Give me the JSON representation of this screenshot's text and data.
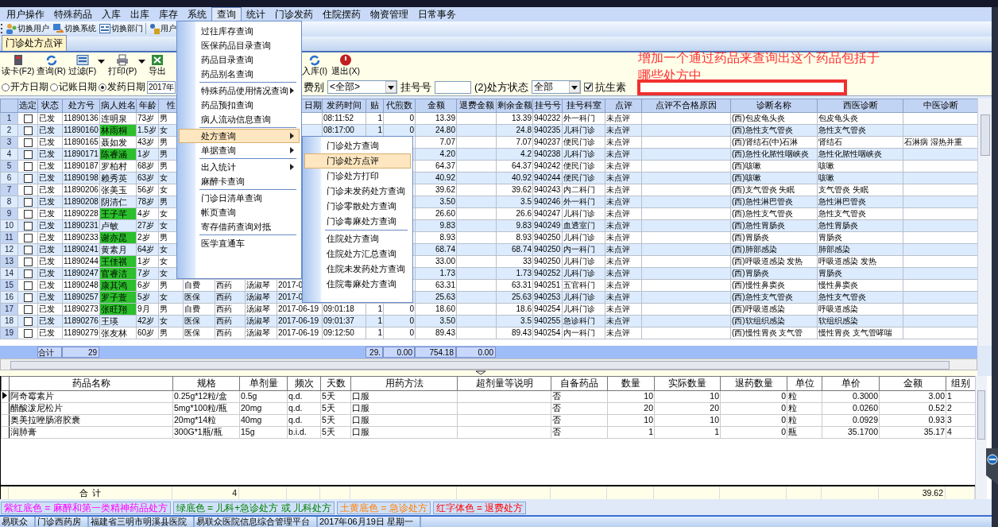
{
  "menubar": [
    {
      "label": "用户操作",
      "selected": false
    },
    {
      "label": "特殊药品",
      "selected": false
    },
    {
      "label": "入库",
      "selected": false
    },
    {
      "label": "出库",
      "selected": false
    },
    {
      "label": "库存",
      "selected": false
    },
    {
      "label": "系统",
      "selected": false
    },
    {
      "label": "查询",
      "selected": true
    },
    {
      "label": "统计",
      "selected": false
    },
    {
      "label": "门诊发药",
      "selected": false
    },
    {
      "label": "住院摆药",
      "selected": false
    },
    {
      "label": "物资管理",
      "selected": false
    },
    {
      "label": "日常事务",
      "selected": false
    }
  ],
  "toolbar": [
    {
      "label": "切换用户"
    },
    {
      "label": "切换系统"
    },
    {
      "label": "切换部门"
    },
    {
      "label": "用户"
    }
  ],
  "tabs": [
    {
      "label": "门诊处方点评",
      "selected": true
    }
  ],
  "actions_left": [
    {
      "label": "读卡(F2)",
      "dropdown": false
    },
    {
      "label": "查询(R)",
      "dropdown": false
    },
    {
      "label": "过滤(F)",
      "dropdown": true
    },
    {
      "label": "打印(P)",
      "dropdown": true
    },
    {
      "label": "导出",
      "dropdown": false
    }
  ],
  "actions_right": [
    {
      "label": "入库(I)"
    },
    {
      "label": "退出(X)"
    }
  ],
  "annotation": "增加一个通过药品来查询出这个药品包括于哪些处方中",
  "filter": {
    "date_modes": [
      {
        "label": "开方日期",
        "selected": false
      },
      {
        "label": "记账日期",
        "selected": false
      },
      {
        "label": "发药日期",
        "selected": true
      }
    ],
    "date_from": "2017年",
    "fee_label": "费别",
    "fee_value": "<全部>",
    "reg_label": "挂号号",
    "status_label": "(2)处方状态",
    "status_value": "全部",
    "antibiotic": {
      "label": "抗生素",
      "checked": true
    }
  },
  "top_table": {
    "columns": [
      null,
      "选定",
      "状态",
      "处方号",
      "病人姓名",
      "年龄",
      "性",
      null,
      null,
      null,
      "日期",
      "发药时间",
      "贴",
      "代煎数",
      "金额",
      "退费金额",
      "剩余金额",
      "挂号号",
      "挂号科室",
      "点评",
      "点评不合格原因",
      "诊断名称",
      "西医诊断",
      "中医诊断"
    ],
    "rows": [
      {
        "checked": false,
        "highlighted": false,
        "cells": [
          "1",
          null,
          "已发",
          "11890136",
          "连明泉",
          "73岁",
          "男",
          null,
          null,
          null,
          null,
          "08:11:52",
          "1",
          "0",
          "13.39",
          null,
          "13.39",
          "940232",
          "外一科门",
          "未点评",
          null,
          "(西)包皮龟头炎",
          "包皮龟头炎",
          null
        ]
      },
      {
        "checked": false,
        "highlighted": true,
        "cells": [
          "2",
          null,
          "已发",
          "11890160",
          "林雨桐",
          "1.5岁",
          "女",
          null,
          null,
          null,
          null,
          "08:17:00",
          "1",
          "0",
          "24.80",
          null,
          "24.8",
          "940235",
          "儿科门诊",
          "未点评",
          null,
          "(西)急性支气管炎",
          "急性支气管炎",
          null
        ]
      },
      {
        "checked": false,
        "highlighted": false,
        "cells": [
          "3",
          null,
          "已发",
          "11890165",
          "聂如发",
          "43岁",
          "男",
          null,
          null,
          null,
          null,
          null,
          null,
          null,
          "7.07",
          null,
          "7.07",
          "940237",
          "便民门诊",
          "未点评",
          null,
          "(西)肾结石(中)石淋",
          "肾结石",
          "石淋病 湿热并重"
        ]
      },
      {
        "checked": false,
        "highlighted": true,
        "cells": [
          "4",
          null,
          "已发",
          "11890171",
          "陈睿涵",
          "1岁",
          "男",
          null,
          null,
          null,
          null,
          null,
          null,
          null,
          "4.20",
          null,
          "4.2",
          "940238",
          "儿科门诊",
          "未点评",
          null,
          "(西)急性化脓性咽峡炎",
          "急性化脓性咽峡炎",
          null
        ]
      },
      {
        "checked": false,
        "highlighted": false,
        "cells": [
          "5",
          null,
          "已发",
          "11890187",
          "罗柏村",
          "68岁",
          "男",
          null,
          null,
          null,
          null,
          null,
          null,
          null,
          "64.37",
          null,
          "64.37",
          "940242",
          "便民门诊",
          "未点评",
          null,
          "(西)咳嗽",
          "咳嗽",
          null
        ]
      },
      {
        "checked": false,
        "highlighted": false,
        "cells": [
          "6",
          null,
          "已发",
          "11890198",
          "赖秀英",
          "63岁",
          "女",
          null,
          null,
          null,
          null,
          null,
          null,
          null,
          "40.92",
          null,
          "40.92",
          "940244",
          "便民门诊",
          "未点评",
          null,
          "(西)咳嗽",
          "咳嗽",
          null
        ]
      },
      {
        "checked": false,
        "highlighted": false,
        "cells": [
          "7",
          null,
          "已发",
          "11890206",
          "张美玉",
          "56岁",
          "女",
          null,
          null,
          null,
          null,
          null,
          null,
          null,
          "39.62",
          null,
          "39.62",
          "940243",
          "内二科门",
          "未点评",
          null,
          "(西)支气管炎 失眠",
          "支气管炎 失眠",
          null
        ]
      },
      {
        "checked": false,
        "highlighted": false,
        "cells": [
          "8",
          null,
          "已发",
          "11890208",
          "阴清仁",
          "78岁",
          "男",
          null,
          null,
          null,
          null,
          null,
          null,
          null,
          "3.50",
          null,
          "3.5",
          "940246",
          "外一科门",
          "未点评",
          null,
          "(西)急性淋巴管炎",
          "急性淋巴管炎",
          null
        ]
      },
      {
        "checked": false,
        "highlighted": true,
        "cells": [
          "9",
          null,
          "已发",
          "11890228",
          "王子芊",
          "4岁",
          "女",
          null,
          null,
          null,
          null,
          null,
          null,
          null,
          "26.60",
          null,
          "26.6",
          "940247",
          "儿科门诊",
          "未点评",
          null,
          "(西)急性支气管炎",
          "急性支气管炎",
          null
        ]
      },
      {
        "checked": false,
        "highlighted": false,
        "cells": [
          "10",
          null,
          "已发",
          "11890231",
          "卢敏",
          "27岁",
          "女",
          null,
          null,
          null,
          null,
          null,
          null,
          null,
          "9.83",
          null,
          "9.83",
          "940249",
          "血透室门",
          "未点评",
          null,
          "(西)急性胃肠炎",
          "急性胃肠炎",
          null
        ]
      },
      {
        "checked": false,
        "highlighted": true,
        "cells": [
          "11",
          null,
          "已发",
          "11890233",
          "谢亦昆",
          "2岁",
          "男",
          null,
          null,
          null,
          null,
          null,
          null,
          null,
          "8.93",
          null,
          "8.93",
          "940250",
          "儿科门诊",
          "未点评",
          null,
          "(西)胃肠炎",
          "胃肠炎",
          null
        ]
      },
      {
        "checked": false,
        "highlighted": false,
        "cells": [
          "12",
          null,
          "已发",
          "11890241",
          "黄素月",
          "64岁",
          "女",
          null,
          null,
          null,
          null,
          null,
          null,
          null,
          "68.74",
          null,
          "68.74",
          "940250",
          "内一科门",
          "未点评",
          null,
          "(西)肺部感染",
          "肺部感染",
          null
        ]
      },
      {
        "checked": false,
        "highlighted": true,
        "cells": [
          "13",
          null,
          "已发",
          "11890244",
          "王佳祺",
          "1岁",
          "女",
          null,
          null,
          null,
          null,
          null,
          null,
          null,
          "33.00",
          null,
          "33",
          "940250",
          "儿科门诊",
          "未点评",
          null,
          "(西)呼吸道感染 发热",
          "呼吸道感染 发热",
          null
        ]
      },
      {
        "checked": false,
        "highlighted": true,
        "cells": [
          "14",
          null,
          "已发",
          "11890247",
          "官睿洁",
          "7岁",
          "女",
          null,
          null,
          null,
          null,
          null,
          null,
          null,
          "1.73",
          null,
          "1.73",
          "940252",
          "儿科门诊",
          "未点评",
          null,
          "(西)胃肠炎",
          "胃肠炎",
          null
        ]
      },
      {
        "checked": false,
        "highlighted": true,
        "cells": [
          "15",
          null,
          "已发",
          "11890248",
          "康其鸿",
          "6岁",
          "男",
          "自费",
          "西药",
          "汤淑琴",
          "2017-0",
          null,
          null,
          null,
          "63.31",
          null,
          "63.31",
          "940251",
          "五官科门",
          "未点评",
          null,
          "(西)慢性鼻窦炎",
          "慢性鼻窦炎",
          null
        ]
      },
      {
        "checked": false,
        "highlighted": true,
        "cells": [
          "16",
          null,
          "已发",
          "11890257",
          "罗子萱",
          "5岁",
          "女",
          "医保",
          "西药",
          "汤淑琴",
          "2017-0",
          null,
          null,
          null,
          "25.63",
          null,
          "25.63",
          "940253",
          "儿科门诊",
          "未点评",
          null,
          "(西)急性支气管炎",
          "急性支气管炎",
          null
        ]
      },
      {
        "checked": false,
        "highlighted": true,
        "cells": [
          "17",
          null,
          "已发",
          "11890273",
          "张旺翔",
          "9月",
          "男",
          "自费",
          "西药",
          "汤淑琴",
          "2017-06-19",
          "09:01:18",
          "1",
          "0",
          "18.60",
          null,
          "18.6",
          "940254",
          "儿科门诊",
          "未点评",
          null,
          "(西)呼吸道感染",
          "呼吸道感染",
          null
        ]
      },
      {
        "checked": false,
        "highlighted": false,
        "cells": [
          "18",
          null,
          "已发",
          "11890276",
          "王瑛",
          "42岁",
          "女",
          "医保",
          "西药",
          "汤淑琴",
          "2017-06-19",
          "09:01:37",
          "1",
          "0",
          "3.50",
          null,
          "3.5",
          "940255",
          "急诊科门",
          "未点评",
          null,
          "(西)软组织感染",
          "软组织感染",
          null
        ]
      },
      {
        "checked": false,
        "highlighted": false,
        "cells": [
          "19",
          null,
          "已发",
          "11890279",
          "张友林",
          "60岁",
          "男",
          "医保",
          "西药",
          "汤淑琴",
          "2017-06-19",
          "09:12:50",
          "1",
          "0",
          "89.43",
          null,
          "89.43",
          "940254",
          "内一科门",
          "未点评",
          null,
          "(西)慢性胃炎 支气管",
          "慢性胃炎 支气管哮喘",
          null
        ]
      }
    ],
    "total": {
      "label": "合计",
      "count": "29",
      "doses": "29.",
      "decoct": "0.00",
      "amount": "754.18",
      "refund": "0.00"
    }
  },
  "menu": [
    {
      "kind": "item",
      "label": "过往库存查询",
      "submenu": false,
      "selected": false
    },
    {
      "kind": "item",
      "label": "医保药品目录查询",
      "submenu": false,
      "selected": false
    },
    {
      "kind": "item",
      "label": "药品目录查询",
      "submenu": false,
      "selected": false
    },
    {
      "kind": "item",
      "label": "药品别名查询",
      "submenu": false,
      "selected": false
    },
    {
      "kind": "separator"
    },
    {
      "kind": "item",
      "label": "特殊药品使用情况查询",
      "submenu": true,
      "selected": false
    },
    {
      "kind": "item",
      "label": "药品预扣查询",
      "submenu": false,
      "selected": false
    },
    {
      "kind": "item",
      "label": "病人流动信息查询",
      "submenu": false,
      "selected": false
    },
    {
      "kind": "separator"
    },
    {
      "kind": "item",
      "label": "处方查询",
      "submenu": true,
      "selected": true
    },
    {
      "kind": "item",
      "label": "单据查询",
      "submenu": true,
      "selected": false
    },
    {
      "kind": "separator"
    },
    {
      "kind": "item",
      "label": "出入统计",
      "submenu": true,
      "selected": false
    },
    {
      "kind": "item",
      "label": "麻醉卡查询",
      "submenu": false,
      "selected": false
    },
    {
      "kind": "separator"
    },
    {
      "kind": "item",
      "label": "门诊日清单查询",
      "submenu": false,
      "selected": false
    },
    {
      "kind": "item",
      "label": "帐页查询",
      "submenu": false,
      "selected": false
    },
    {
      "kind": "item",
      "label": "寄存借药查询对抵",
      "submenu": false,
      "selected": false
    },
    {
      "kind": "separator"
    },
    {
      "kind": "item",
      "label": "医学直通车",
      "submenu": false,
      "selected": false
    }
  ],
  "submenu": [
    {
      "kind": "item",
      "label": "门诊处方查询",
      "selected": false
    },
    {
      "kind": "item",
      "label": "门诊处方点评",
      "selected": true
    },
    {
      "kind": "item",
      "label": "门诊处方打印",
      "selected": false
    },
    {
      "kind": "item",
      "label": "门诊未发药处方查询",
      "selected": false
    },
    {
      "kind": "item",
      "label": "门诊零散处方查询",
      "selected": false
    },
    {
      "kind": "item",
      "label": "门诊毒麻处方查询",
      "selected": false
    },
    {
      "kind": "separator"
    },
    {
      "kind": "item",
      "label": "住院处方查询",
      "selected": false
    },
    {
      "kind": "item",
      "label": "住院处方汇总查询",
      "selected": false
    },
    {
      "kind": "item",
      "label": "住院未发药处方查询",
      "selected": false
    },
    {
      "kind": "item",
      "label": "住院毒麻处方查询",
      "selected": false
    }
  ],
  "detail_table": {
    "columns": [
      "药品名称",
      "规格",
      "单剂量",
      "频次",
      "天数",
      "用药方法",
      "超剂量等说明",
      "自备药品",
      "数量",
      "实际数量",
      "退药数量",
      "单位",
      "单价",
      "金额",
      "组别"
    ],
    "rows": [
      {
        "current": true,
        "cells": [
          "阿奇霉素片",
          "0.25g*12粒/盒",
          "0.5g",
          "q.d.",
          "5天",
          "口服",
          null,
          "否",
          "10",
          "10",
          "0",
          "粒",
          "0.3000",
          "3.00",
          "1"
        ]
      },
      {
        "current": false,
        "cells": [
          "醋酸泼尼松片",
          "5mg*100粒/瓶",
          "20mg",
          "q.d.",
          "5天",
          "口服",
          null,
          "否",
          "20",
          "20",
          "0",
          "粒",
          "0.0260",
          "0.52",
          "2"
        ]
      },
      {
        "current": false,
        "cells": [
          "奥美拉唑肠溶胶囊",
          "20mg*14粒",
          "40mg",
          "q.d.",
          "5天",
          "口服",
          null,
          "否",
          "10",
          "10",
          "0",
          "粒",
          "0.0929",
          "0.93",
          "3"
        ]
      },
      {
        "current": false,
        "cells": [
          "润肺膏",
          "300G*1瓶/瓶",
          "15g",
          "b.i.d.",
          "5天",
          "口服",
          null,
          "否",
          "1",
          "1",
          "0",
          "瓶",
          "35.1700",
          "35.17",
          "4"
        ]
      }
    ],
    "total": {
      "label": "合  计",
      "count": "4",
      "amount": "39.62"
    }
  },
  "legend": [
    {
      "text": "紫红底色 = 麻醉和第一类精神药品处方",
      "color": "#ff00ff"
    },
    {
      "text": "绿底色 = 儿科+急诊处方 或 儿科处方",
      "color": "#008000"
    },
    {
      "text": "土黄底色 = 急诊处方",
      "color": "#ff8000"
    },
    {
      "text": "红字体色 = 退费处方",
      "color": "#ff0000"
    }
  ],
  "status_bar": [
    "易联众",
    "门诊西药房",
    "福建省三明市明溪县医院",
    "易联众医院信息综合管理平台",
    "2017年06月19日 星期一"
  ]
}
